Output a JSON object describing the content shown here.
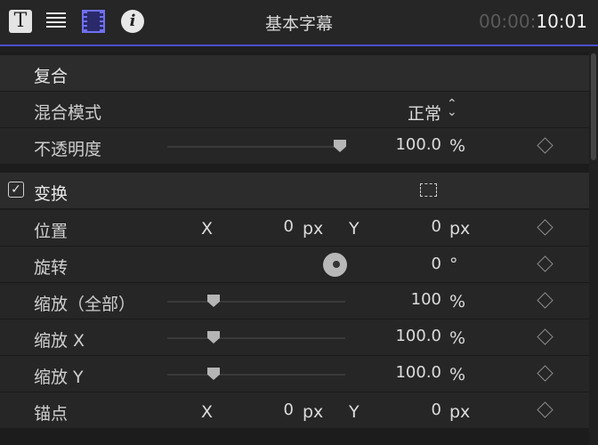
{
  "header": {
    "title": "基本字幕",
    "timecode_dim": "00:00:",
    "timecode_bright": "10:01",
    "icons": [
      "text-icon",
      "lines-icon",
      "film-icon",
      "info-icon"
    ],
    "accent_color": "#4b4fd1",
    "text_icon_glyph": "T",
    "info_icon_glyph": "i"
  },
  "composite": {
    "title": "复合",
    "blend_mode": {
      "label": "混合模式",
      "value": "正常"
    },
    "opacity": {
      "label": "不透明度",
      "value": "100.0",
      "unit": "%",
      "slider_fraction": 0.97
    }
  },
  "transform": {
    "title": "变换",
    "enabled": true,
    "position": {
      "label": "位置",
      "x_label": "X",
      "x": "0",
      "x_unit": "px",
      "y_label": "Y",
      "y": "0",
      "y_unit": "px"
    },
    "rotation": {
      "label": "旋转",
      "value": "0",
      "unit": "°"
    },
    "scale_all": {
      "label": "缩放（全部）",
      "value": "100",
      "unit": "%",
      "slider_fraction": 0.26
    },
    "scale_x": {
      "label": "缩放 X",
      "value": "100.0",
      "unit": "%",
      "slider_fraction": 0.26
    },
    "scale_y": {
      "label": "缩放 Y",
      "value": "100.0",
      "unit": "%",
      "slider_fraction": 0.26
    },
    "anchor": {
      "label": "锚点",
      "x_label": "X",
      "x": "0",
      "x_unit": "px",
      "y_label": "Y",
      "y": "0",
      "y_unit": "px"
    }
  }
}
